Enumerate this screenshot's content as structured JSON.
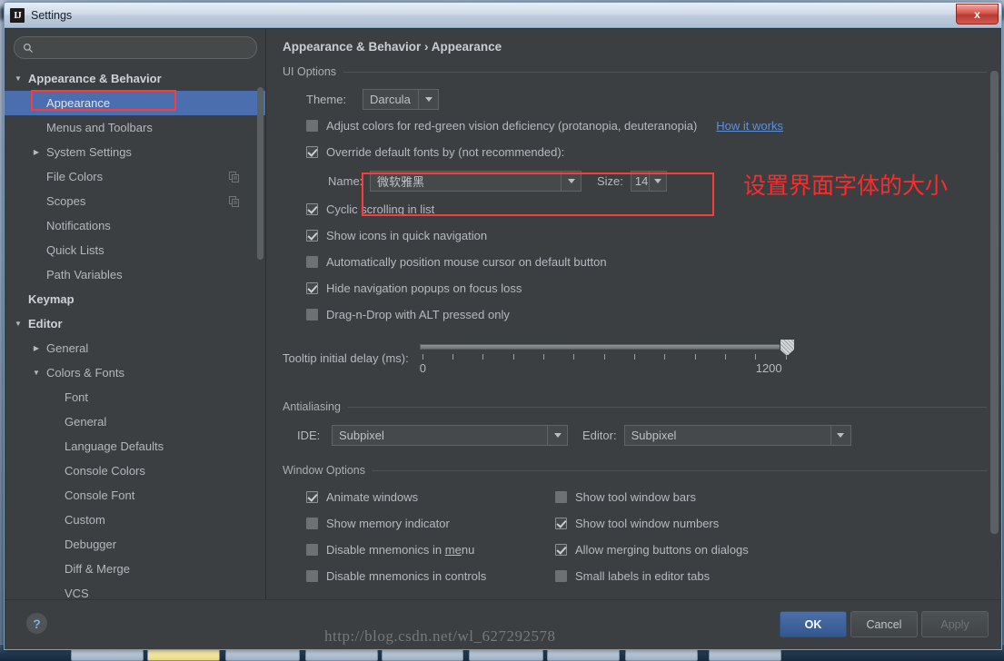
{
  "window": {
    "title": "Settings",
    "app_icon": "IJ",
    "close_label": "x"
  },
  "search": {
    "placeholder": "",
    "value": "",
    "icon": "search-icon"
  },
  "sidebar": {
    "items": [
      {
        "label": "Appearance & Behavior",
        "indent": 0,
        "arrow": "down",
        "bold": true,
        "selected": false
      },
      {
        "label": "Appearance",
        "indent": 1,
        "arrow": "none",
        "bold": false,
        "selected": true
      },
      {
        "label": "Menus and Toolbars",
        "indent": 1,
        "arrow": "none",
        "bold": false,
        "selected": false
      },
      {
        "label": "System Settings",
        "indent": 1,
        "arrow": "right",
        "bold": false,
        "selected": false
      },
      {
        "label": "File Colors",
        "indent": 1,
        "arrow": "none",
        "bold": false,
        "selected": false,
        "trailing_icon": "copy-icon"
      },
      {
        "label": "Scopes",
        "indent": 1,
        "arrow": "none",
        "bold": false,
        "selected": false,
        "trailing_icon": "copy-icon"
      },
      {
        "label": "Notifications",
        "indent": 1,
        "arrow": "none",
        "bold": false,
        "selected": false
      },
      {
        "label": "Quick Lists",
        "indent": 1,
        "arrow": "none",
        "bold": false,
        "selected": false
      },
      {
        "label": "Path Variables",
        "indent": 1,
        "arrow": "none",
        "bold": false,
        "selected": false
      },
      {
        "label": "Keymap",
        "indent": 0,
        "arrow": "none",
        "bold": true,
        "selected": false
      },
      {
        "label": "Editor",
        "indent": 0,
        "arrow": "down",
        "bold": true,
        "selected": false
      },
      {
        "label": "General",
        "indent": 1,
        "arrow": "right",
        "bold": false,
        "selected": false
      },
      {
        "label": "Colors & Fonts",
        "indent": 1,
        "arrow": "down",
        "bold": false,
        "selected": false
      },
      {
        "label": "Font",
        "indent": 2,
        "arrow": "none",
        "bold": false,
        "selected": false
      },
      {
        "label": "General",
        "indent": 2,
        "arrow": "none",
        "bold": false,
        "selected": false
      },
      {
        "label": "Language Defaults",
        "indent": 2,
        "arrow": "none",
        "bold": false,
        "selected": false
      },
      {
        "label": "Console Colors",
        "indent": 2,
        "arrow": "none",
        "bold": false,
        "selected": false
      },
      {
        "label": "Console Font",
        "indent": 2,
        "arrow": "none",
        "bold": false,
        "selected": false
      },
      {
        "label": "Custom",
        "indent": 2,
        "arrow": "none",
        "bold": false,
        "selected": false
      },
      {
        "label": "Debugger",
        "indent": 2,
        "arrow": "none",
        "bold": false,
        "selected": false
      },
      {
        "label": "Diff & Merge",
        "indent": 2,
        "arrow": "none",
        "bold": false,
        "selected": false
      },
      {
        "label": "VCS",
        "indent": 2,
        "arrow": "none",
        "bold": false,
        "selected": false
      }
    ]
  },
  "main": {
    "breadcrumb": "Appearance & Behavior › Appearance",
    "ui_options": {
      "title": "UI Options",
      "theme_label": "Theme:",
      "theme_value": "Darcula",
      "adjust_colors": {
        "label": "Adjust colors for red-green vision deficiency (protanopia, deuteranopia)",
        "checked": false,
        "link": "How it works"
      },
      "override_fonts": {
        "label": "Override default fonts by (not recommended):",
        "checked": true
      },
      "name_label": "Name:",
      "name_value": "微软雅黑",
      "size_label": "Size:",
      "size_value": "14",
      "checkboxes": [
        {
          "label": "Cyclic scrolling in list",
          "checked": true
        },
        {
          "label": "Show icons in quick navigation",
          "checked": true
        },
        {
          "label": "Automatically position mouse cursor on default button",
          "checked": false
        },
        {
          "label": "Hide navigation popups on focus loss",
          "checked": true
        },
        {
          "label": "Drag-n-Drop with ALT pressed only",
          "checked": false
        }
      ],
      "tooltip_delay_label": "Tooltip initial delay (ms):",
      "tooltip_delay_min": "0",
      "tooltip_delay_max": "1200",
      "tooltip_delay_value": 1200
    },
    "antialiasing": {
      "title": "Antialiasing",
      "ide_label": "IDE:",
      "ide_value": "Subpixel",
      "editor_label": "Editor:",
      "editor_value": "Subpixel"
    },
    "window_options": {
      "title": "Window Options",
      "left": [
        {
          "label": "Animate windows",
          "checked": true
        },
        {
          "label": "Show memory indicator",
          "checked": false
        },
        {
          "label": "Disable mnemonics in menu",
          "checked": false,
          "mnemonic": "me"
        },
        {
          "label": "Disable mnemonics in controls",
          "checked": false
        }
      ],
      "right": [
        {
          "label": "Show tool window bars",
          "checked": false
        },
        {
          "label": "Show tool window numbers",
          "checked": true
        },
        {
          "label": "Allow merging buttons on dialogs",
          "checked": true
        },
        {
          "label": "Small labels in editor tabs",
          "checked": false
        }
      ]
    }
  },
  "footer": {
    "help_label": "?",
    "ok_label": "OK",
    "cancel_label": "Cancel",
    "apply_label": "Apply"
  },
  "annotations": {
    "note_text": "设置界面字体的大小",
    "note_color": "#fb2c2c",
    "highlight_color": "#fd3b3b"
  },
  "watermark": {
    "text": "http://blog.csdn.net/wl_627292578"
  }
}
